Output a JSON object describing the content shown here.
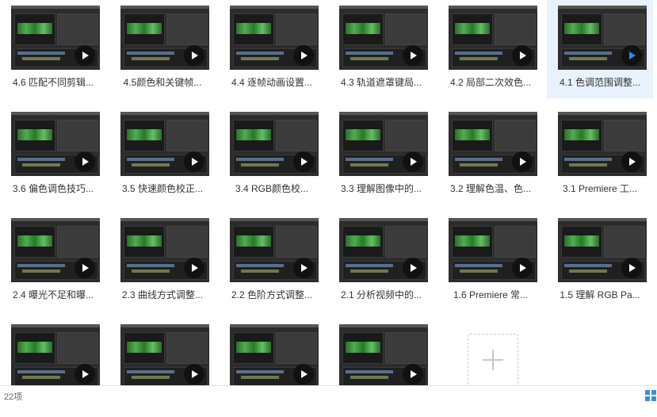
{
  "files": [
    {
      "label": "4.6 匹配不同剪辑..."
    },
    {
      "label": "4.5颜色和关键帧..."
    },
    {
      "label": "4.4 逐帧动画设置..."
    },
    {
      "label": "4.3 轨道遮罩键局..."
    },
    {
      "label": "4.2 局部二次效色..."
    },
    {
      "label": "4.1 色调范围调整...",
      "selected": true
    },
    {
      "label": "3.6 偏色调色技巧..."
    },
    {
      "label": "3.5 快速颜色校正..."
    },
    {
      "label": "3.4 RGB颜色校..."
    },
    {
      "label": "3.3 理解图像中的..."
    },
    {
      "label": "3.2 理解色温、色..."
    },
    {
      "label": "3.1 Premiere 工..."
    },
    {
      "label": "2.4 曝光不足和曝..."
    },
    {
      "label": "2.3 曲线方式调整..."
    },
    {
      "label": "2.2 色阶方式调整..."
    },
    {
      "label": "2.1 分析视频中的..."
    },
    {
      "label": "1.6 Premiere 常..."
    },
    {
      "label": "1.5 理解 RGB Pa..."
    },
    {
      "label": ""
    },
    {
      "label": ""
    },
    {
      "label": ""
    },
    {
      "label": ""
    }
  ],
  "status": {
    "item_count": "22项"
  },
  "colors": {
    "selected_bg": "#e8f2fc",
    "selected_play": "#1e90ff",
    "play_bg": "#111111"
  }
}
